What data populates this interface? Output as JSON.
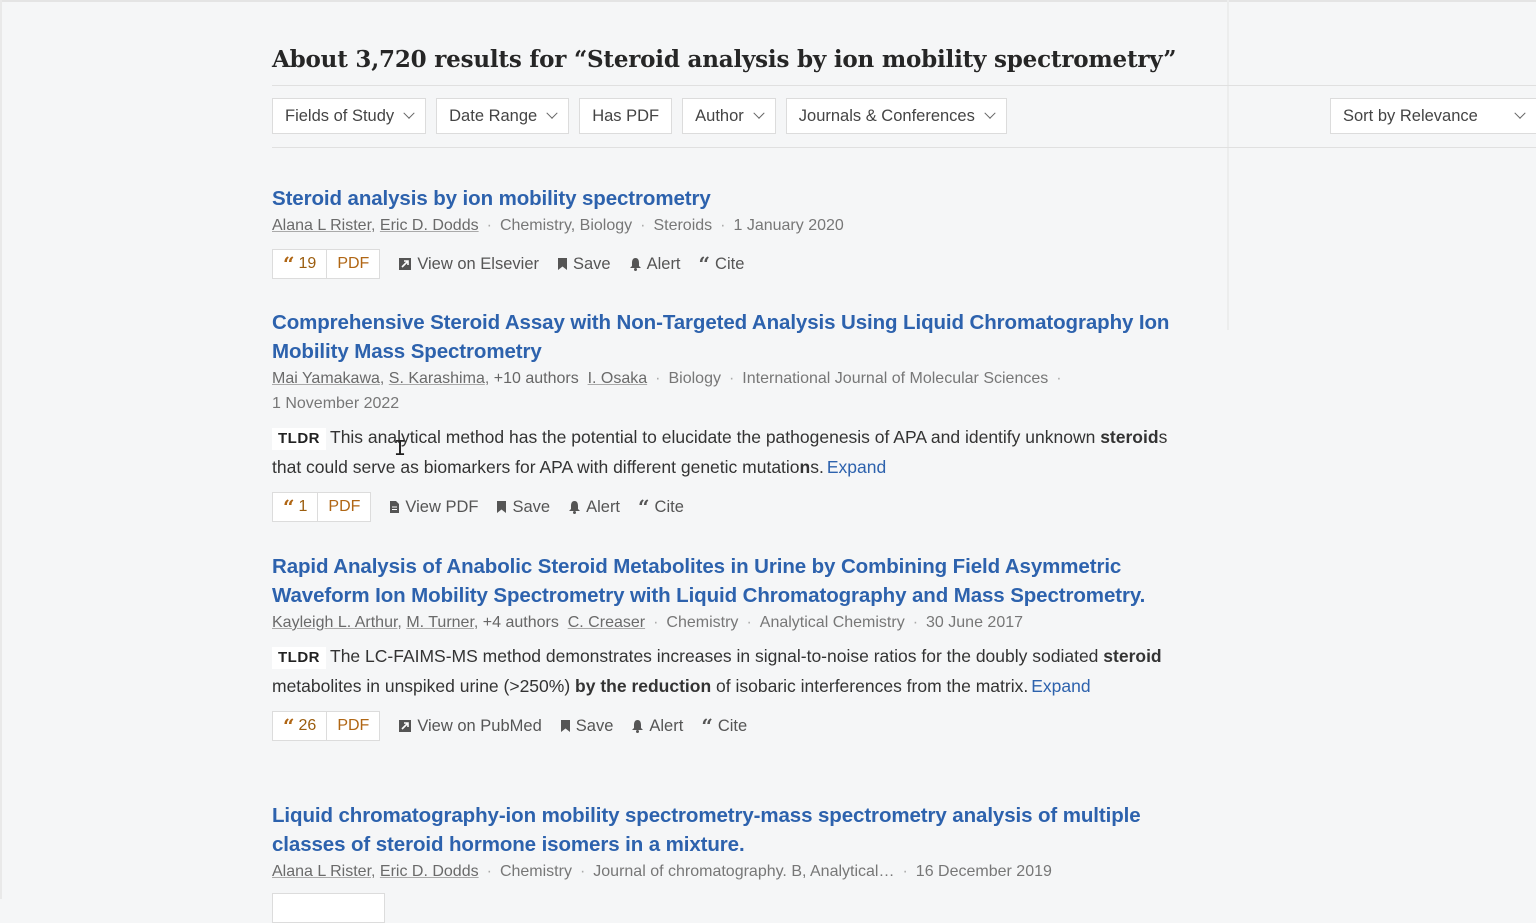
{
  "search": {
    "heading": "About 3,720 results for “Steroid analysis by ion mobility spectrometry”"
  },
  "filters": {
    "fields_of_study": "Fields of Study",
    "date_range": "Date Range",
    "has_pdf": "Has PDF",
    "author": "Author",
    "journals": "Journals & Conferences",
    "sort": "Sort by Relevance"
  },
  "actions": {
    "save": "Save",
    "alert": "Alert",
    "cite": "Cite",
    "pdf": "PDF",
    "tldr": "TLDR",
    "expand": "Expand"
  },
  "papers": [
    {
      "title": "Steroid analysis by ion mobility spectrometry",
      "authors": [
        "Alana L Rister",
        "Eric D. Dodds"
      ],
      "fields": "Chemistry, Biology",
      "venue": "Steroids",
      "date": "1 January 2020",
      "citations": "19",
      "view_label": "View on Elsevier"
    },
    {
      "title": "Comprehensive Steroid Assay with Non-Targeted Analysis Using Liquid Chromatography Ion Mobility Mass Spectrometry",
      "authors": [
        "Mai Yamakawa",
        "S. Karashima"
      ],
      "more_authors": "+10 authors",
      "last_author": "I. Osaka",
      "fields": "Biology",
      "venue": "International Journal of Molecular Sciences",
      "date": "1 November 2022",
      "tldr_parts": [
        "This analytical method has the potential to elucidate the pathogenesis of APA and identify unknown ",
        "steroid",
        "s that could serve as biomarkers for APA with different genetic mutatio",
        "n",
        "s."
      ],
      "citations": "1",
      "view_label": "View PDF"
    },
    {
      "title": "Rapid Analysis of Anabolic Steroid Metabolites in Urine by Combining Field Asymmetric Waveform Ion Mobility Spectrometry with Liquid Chromatography and Mass Spectrometry.",
      "authors": [
        "Kayleigh L. Arthur",
        "M. Turner"
      ],
      "more_authors": "+4 authors",
      "last_author": "C. Creaser",
      "fields": "Chemistry",
      "venue": "Analytical Chemistry",
      "date": "30 June 2017",
      "tldr_parts": [
        "The LC-FAIMS-MS method demonstrates increases in signal-to-noise ratios for the doubly sodiated ",
        "steroid",
        " metabolites in unspiked urine (>250%) ",
        "by",
        " the reduction",
        " of isobaric interferences from the matrix."
      ],
      "citations": "26",
      "view_label": "View on PubMed"
    },
    {
      "title": "Liquid chromatography-ion mobility spectrometry-mass spectrometry analysis of multiple classes of steroid hormone isomers in a mixture.",
      "authors": [
        "Alana L Rister",
        "Eric D. Dodds"
      ],
      "fields": "Chemistry",
      "venue": "Journal of chromatography. B, Analytical…",
      "date": "16 December 2019"
    }
  ]
}
